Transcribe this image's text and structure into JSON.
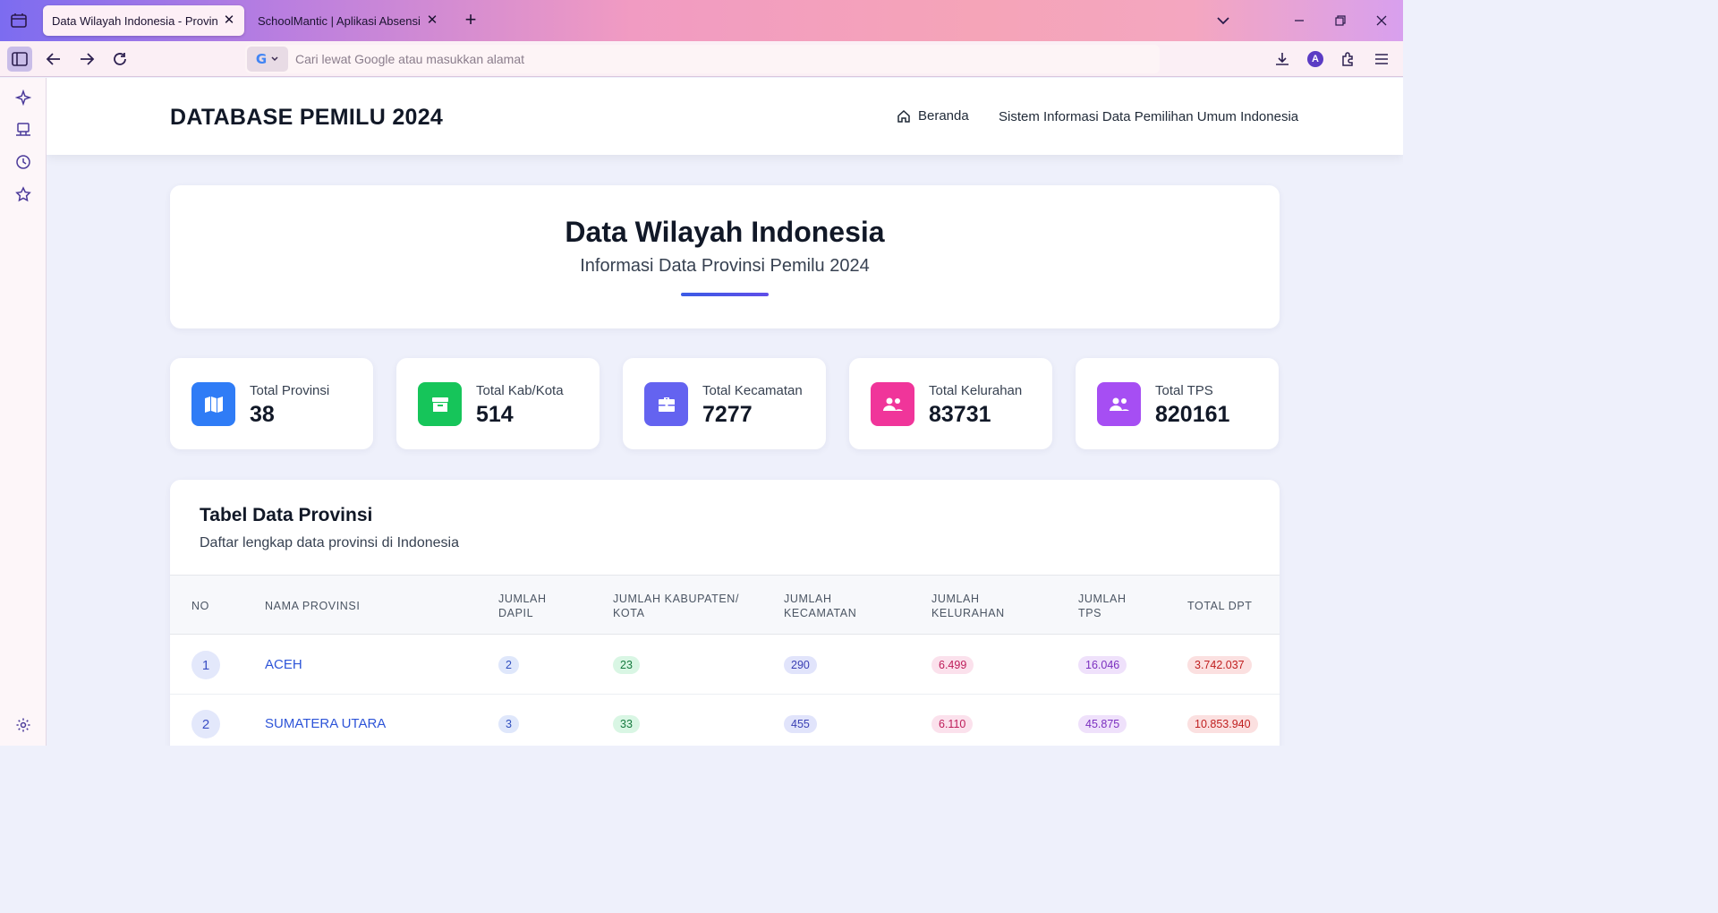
{
  "browser": {
    "tabs": [
      {
        "title": "Data Wilayah Indonesia - Provinsi - ",
        "active": true
      },
      {
        "title": "SchoolMantic | Aplikasi Absensi Sek",
        "active": false
      }
    ],
    "url_placeholder": "Cari lewat Google atau masukkan alamat",
    "search_engine": "Google",
    "profile_initial": "A"
  },
  "site": {
    "title": "DATABASE PEMILU 2024",
    "nav_home": "Beranda",
    "nav_info": "Sistem Informasi Data Pemilihan Umum Indonesia"
  },
  "hero": {
    "title": "Data Wilayah Indonesia",
    "subtitle": "Informasi Data Provinsi Pemilu 2024"
  },
  "stats": [
    {
      "label": "Total Provinsi",
      "value": "38",
      "color": "#2f7cf6",
      "icon": "map-icon"
    },
    {
      "label": "Total Kab/Kota",
      "value": "514",
      "color": "#16c55a",
      "icon": "archive-icon"
    },
    {
      "label": "Total Kecamatan",
      "value": "7277",
      "color": "#6463f0",
      "icon": "briefcase-icon"
    },
    {
      "label": "Total Kelurahan",
      "value": "83731",
      "color": "#f0359a",
      "icon": "users-icon"
    },
    {
      "label": "Total TPS",
      "value": "820161",
      "color": "#a64ef3",
      "icon": "users-icon"
    }
  ],
  "table": {
    "title": "Tabel Data Provinsi",
    "subtitle": "Daftar lengkap data provinsi di Indonesia",
    "headers": [
      [
        "NO"
      ],
      [
        "NAMA PROVINSI"
      ],
      [
        "JUMLAH",
        "DAPIL"
      ],
      [
        "JUMLAH KABUPATEN/",
        "KOTA"
      ],
      [
        "JUMLAH",
        "KECAMATAN"
      ],
      [
        "JUMLAH",
        "KELURAHAN"
      ],
      [
        "JUMLAH",
        "TPS"
      ],
      [
        "TOTAL DPT"
      ]
    ],
    "rows": [
      {
        "no": "1",
        "nama": "ACEH",
        "dapil": "2",
        "kab": "23",
        "kec": "290",
        "kel": "6.499",
        "tps": "16.046",
        "dpt": "3.742.037"
      },
      {
        "no": "2",
        "nama": "SUMATERA UTARA",
        "dapil": "3",
        "kab": "33",
        "kec": "455",
        "kel": "6.110",
        "tps": "45.875",
        "dpt": "10.853.940"
      }
    ]
  }
}
